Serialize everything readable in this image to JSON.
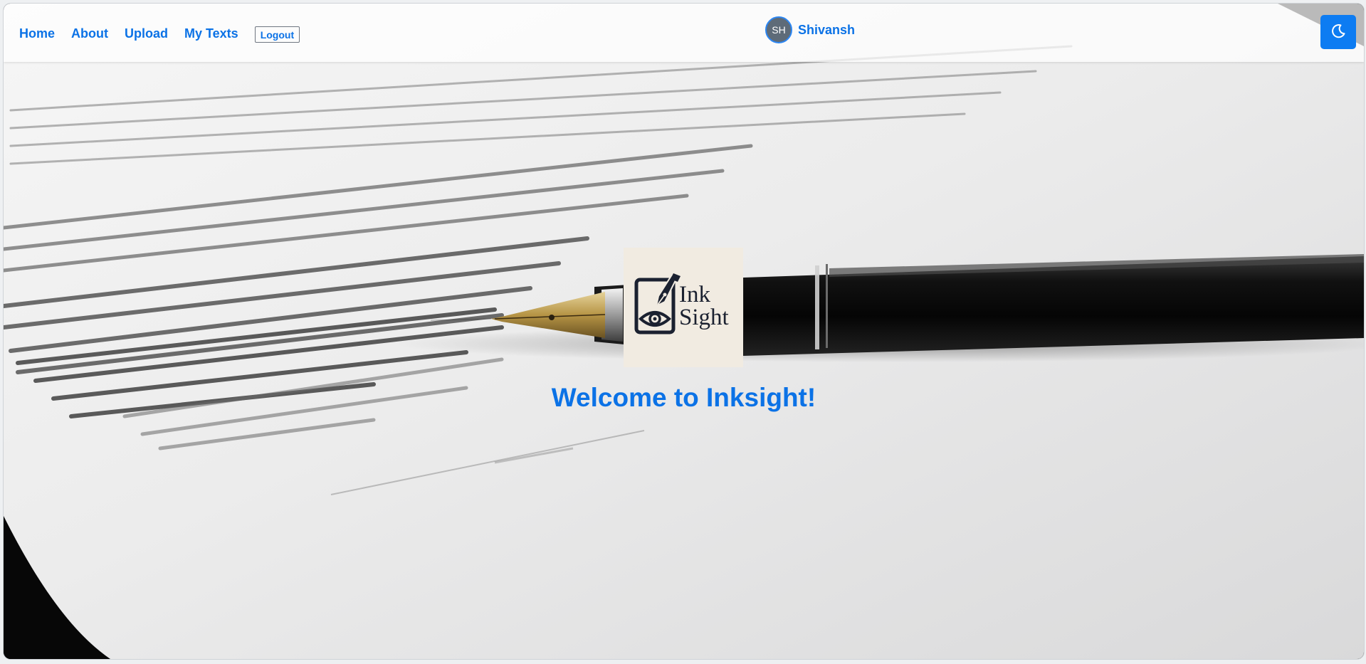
{
  "nav": {
    "links": [
      "Home",
      "About",
      "Upload",
      "My Texts"
    ],
    "logout_label": "Logout"
  },
  "user": {
    "initials": "SH",
    "name": "Shivansh"
  },
  "theme_toggle": {
    "icon": "moon-icon"
  },
  "logo": {
    "line1": "Ink",
    "line2": "Sight",
    "icon": "pen-eye-icon"
  },
  "hero": {
    "welcome": "Welcome to Inksight!",
    "background": "paper-with-fountain-pen"
  },
  "colors": {
    "accent": "#0b72e6",
    "button": "#0d7cf2",
    "logo_ink": "#1b2130",
    "logo_bg": "#f1ebe1"
  }
}
